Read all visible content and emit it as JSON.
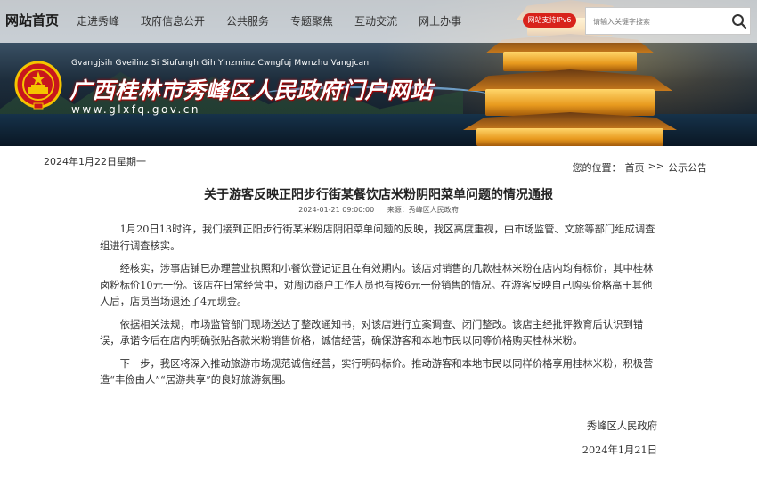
{
  "nav": {
    "home": "网站首页",
    "items": [
      "走进秀峰",
      "政府信息公开",
      "公共服务",
      "专题聚焦",
      "互动交流",
      "网上办事"
    ],
    "ipv6_badge": "网站支持IPv6",
    "search_placeholder": "请输入关键字搜索",
    "search_icon": "search-icon"
  },
  "site": {
    "pinyin": "Gvangjsih Gveilinz Si Siufungh Gih Yinzminz Cwngfuj Mwnzhu Vangjcan",
    "title": "广西桂林市秀峰区人民政府门户网站",
    "url": "www.glxfq.gov.cn"
  },
  "date": "2024年1月22日星期一",
  "breadcrumb": {
    "prefix": "您的位置：",
    "home": "首页",
    "sep": ">>",
    "current": "公示公告"
  },
  "article": {
    "title": "关于游客反映正阳步行街某餐饮店米粉阴阳菜单问题的情况通报",
    "published": "2024-01-21 09:00:00",
    "source_label": "来源：",
    "source": "秀峰区人民政府",
    "paragraphs": [
      "1月20日13时许，我们接到正阳步行街某米粉店阴阳菜单问题的反映，我区高度重视，由市场监管、文旅等部门组成调查组进行调查核实。",
      "经核实，涉事店铺已办理营业执照和小餐饮登记证且在有效期内。该店对销售的几款桂林米粉在店内均有标价，其中桂林卤粉标价10元一份。该店在日常经营中，对周边商户工作人员也有按6元一份销售的情况。在游客反映自己购买价格高于其他人后，店员当场退还了4元现金。",
      "依据相关法规，市场监管部门现场送达了整改通知书，对该店进行立案调查、闭门整改。该店主经批评教育后认识到错误，承诺今后在店内明确张贴各款米粉销售价格，诚信经营，确保游客和本地市民以同等价格购买桂林米粉。",
      "下一步，我区将深入推动旅游市场规范诚信经营，实行明码标价。推动游客和本地市民以同样价格享用桂林米粉，积极营造“丰俭由人”“居游共享”的良好旅游氛围。"
    ],
    "signature": "秀峰区人民政府",
    "sign_date": "2024年1月21日"
  },
  "colors": {
    "badge_red": "#d8231b",
    "title_shadow": "#b40000"
  }
}
